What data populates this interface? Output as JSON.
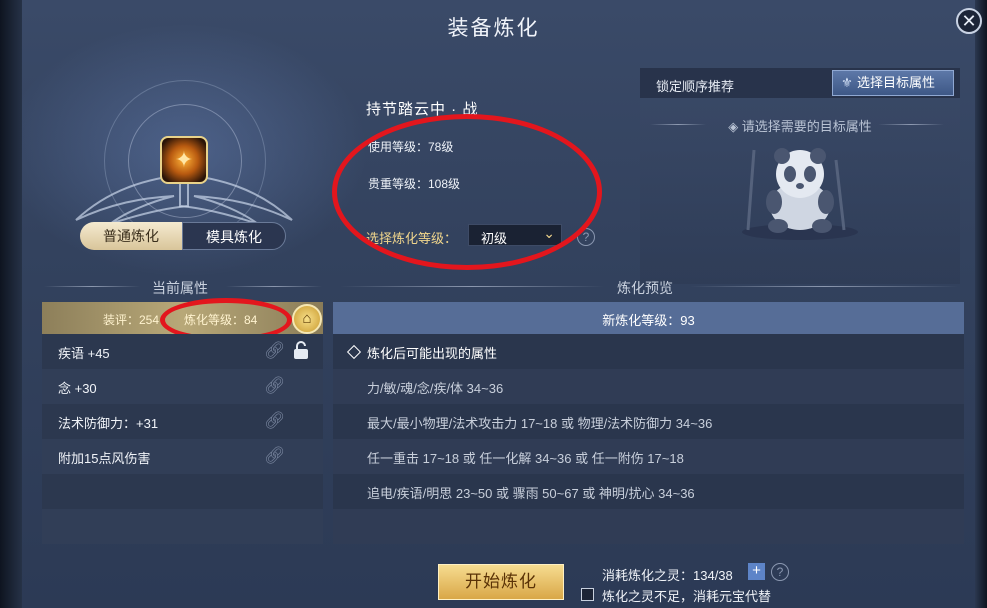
{
  "window": {
    "title": "装备炼化",
    "close_icon": "close-icon"
  },
  "equipment": {
    "name": "持节踏云中 · 战",
    "use_level": "使用等级：78级",
    "rarity_level": "贵重等级：108级",
    "select_label": "选择炼化等级：",
    "select_value": "初级"
  },
  "tabs": [
    {
      "label": "普通炼化",
      "active": true
    },
    {
      "label": "模具炼化",
      "active": false
    }
  ],
  "lock_panel": {
    "title": "锁定顺序推荐",
    "target_button": "选择目标属性",
    "hint": "请选择需要的目标属性"
  },
  "current": {
    "section_title": "当前属性",
    "score": "装评：254",
    "refine_level": "炼化等级：84",
    "attributes": [
      "疾语 +45",
      "念 +30",
      "法术防御力：+31",
      "附加15点风伤害"
    ]
  },
  "preview": {
    "section_title": "炼化预览",
    "new_level": "新炼化等级：93",
    "heading": "炼化后可能出现的属性",
    "lines": [
      "力/敏/魂/念/疾/体 34~36",
      "最大/最小物理/法术攻击力 17~18 或 物理/法术防御力 34~36",
      "任一重击 17~18 或 任一化解 34~36 或 任一附伤 17~18",
      "追电/疾语/明思 23~50 或 骤雨 50~67 或 神明/扰心 34~36"
    ]
  },
  "footer": {
    "start_button": "开始炼化",
    "cost_label": "消耗炼化之灵：134/38",
    "substitute_label": "炼化之灵不足，消耗元宝代替"
  },
  "colors": {
    "accent_gold": "#f1d68c",
    "highlight_red": "#e3161d",
    "preview_header": "#566d97"
  }
}
